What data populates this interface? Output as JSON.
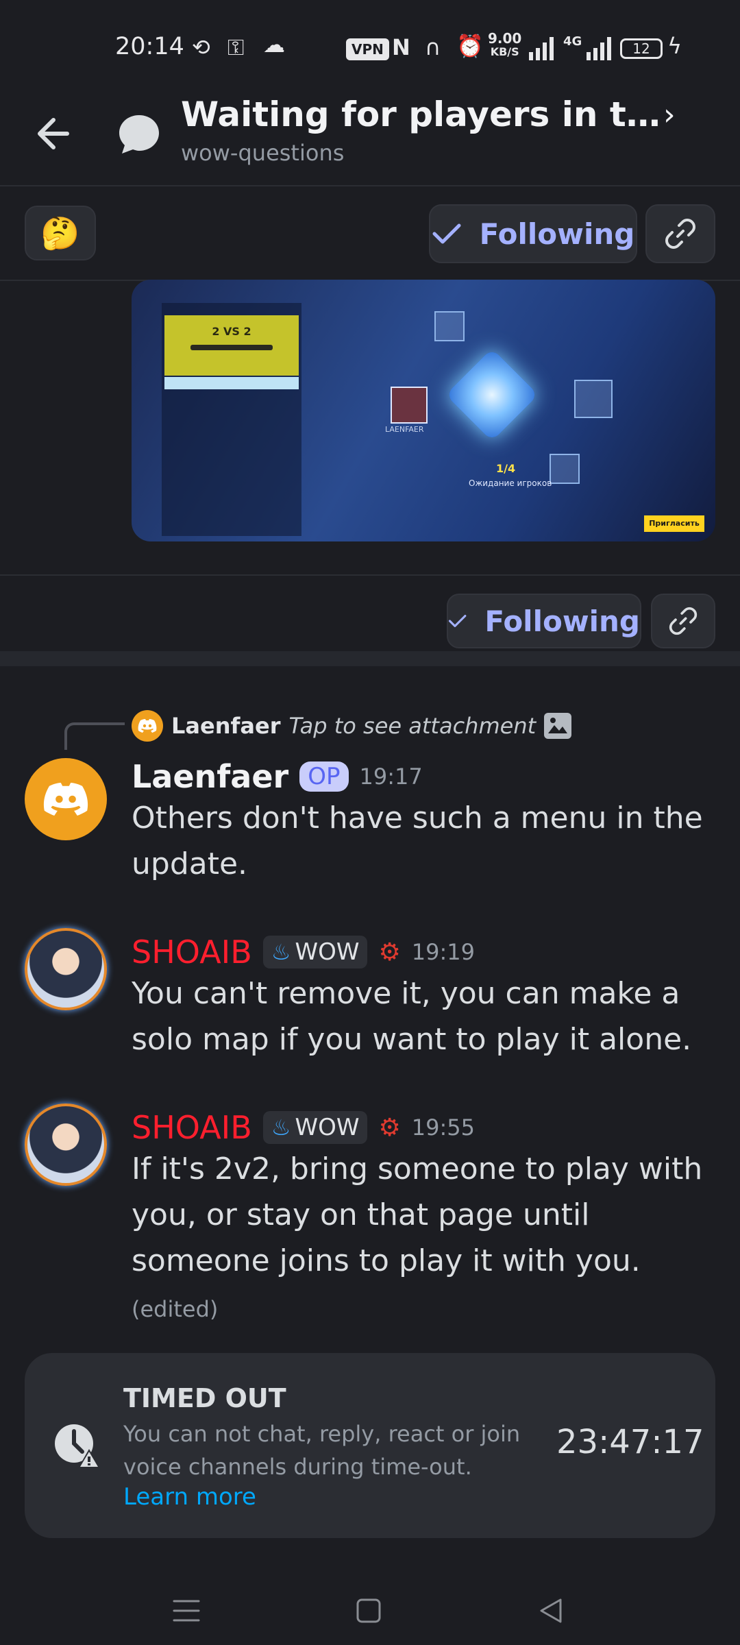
{
  "status_bar": {
    "time": "20:14",
    "vpn": "VPN",
    "speed_value": "9.00",
    "speed_unit": "KB/S",
    "network": "4G",
    "battery": "12"
  },
  "header": {
    "thread_title": "Waiting for players in the m...",
    "channel": "wow-questions"
  },
  "actions": {
    "reaction_emoji": "🤔",
    "following_label": "Following"
  },
  "attachment_image": {
    "mode_label": "2 VS 2",
    "players_count": "1/4",
    "status_text": "Ожидание игроков",
    "player_name": "LAENFAER",
    "invite_button": "Пригласить"
  },
  "reply_preview": {
    "author": "Laenfaer",
    "text": "Tap to see attachment"
  },
  "messages": [
    {
      "author": "Laenfaer",
      "badge": "OP",
      "time": "19:17",
      "text": "Others don't have such a menu in the update."
    },
    {
      "author": "SHOAIB",
      "tag": "WOW",
      "time": "19:19",
      "text": "You can't remove it, you can make a solo map if you want to play it alone."
    },
    {
      "author": "SHOAIB",
      "tag": "WOW",
      "time": "19:55",
      "text": "If it's 2v2, bring someone to play with you, or stay on that page until someone joins to play it with you.",
      "edited": "(edited)"
    }
  ],
  "timeout": {
    "title": "TIMED OUT",
    "description": "You can not chat, reply, react or join voice channels during time-out.",
    "learn_more": "Learn more",
    "remaining": "23:47:17"
  },
  "colors": {
    "background": "#1c1d22",
    "accent": "#a4b1ff",
    "op_badge": "#c9cdfb",
    "author_red": "#ff1f2e",
    "link": "#00a8fc",
    "discord_orange": "#f0a01e"
  }
}
